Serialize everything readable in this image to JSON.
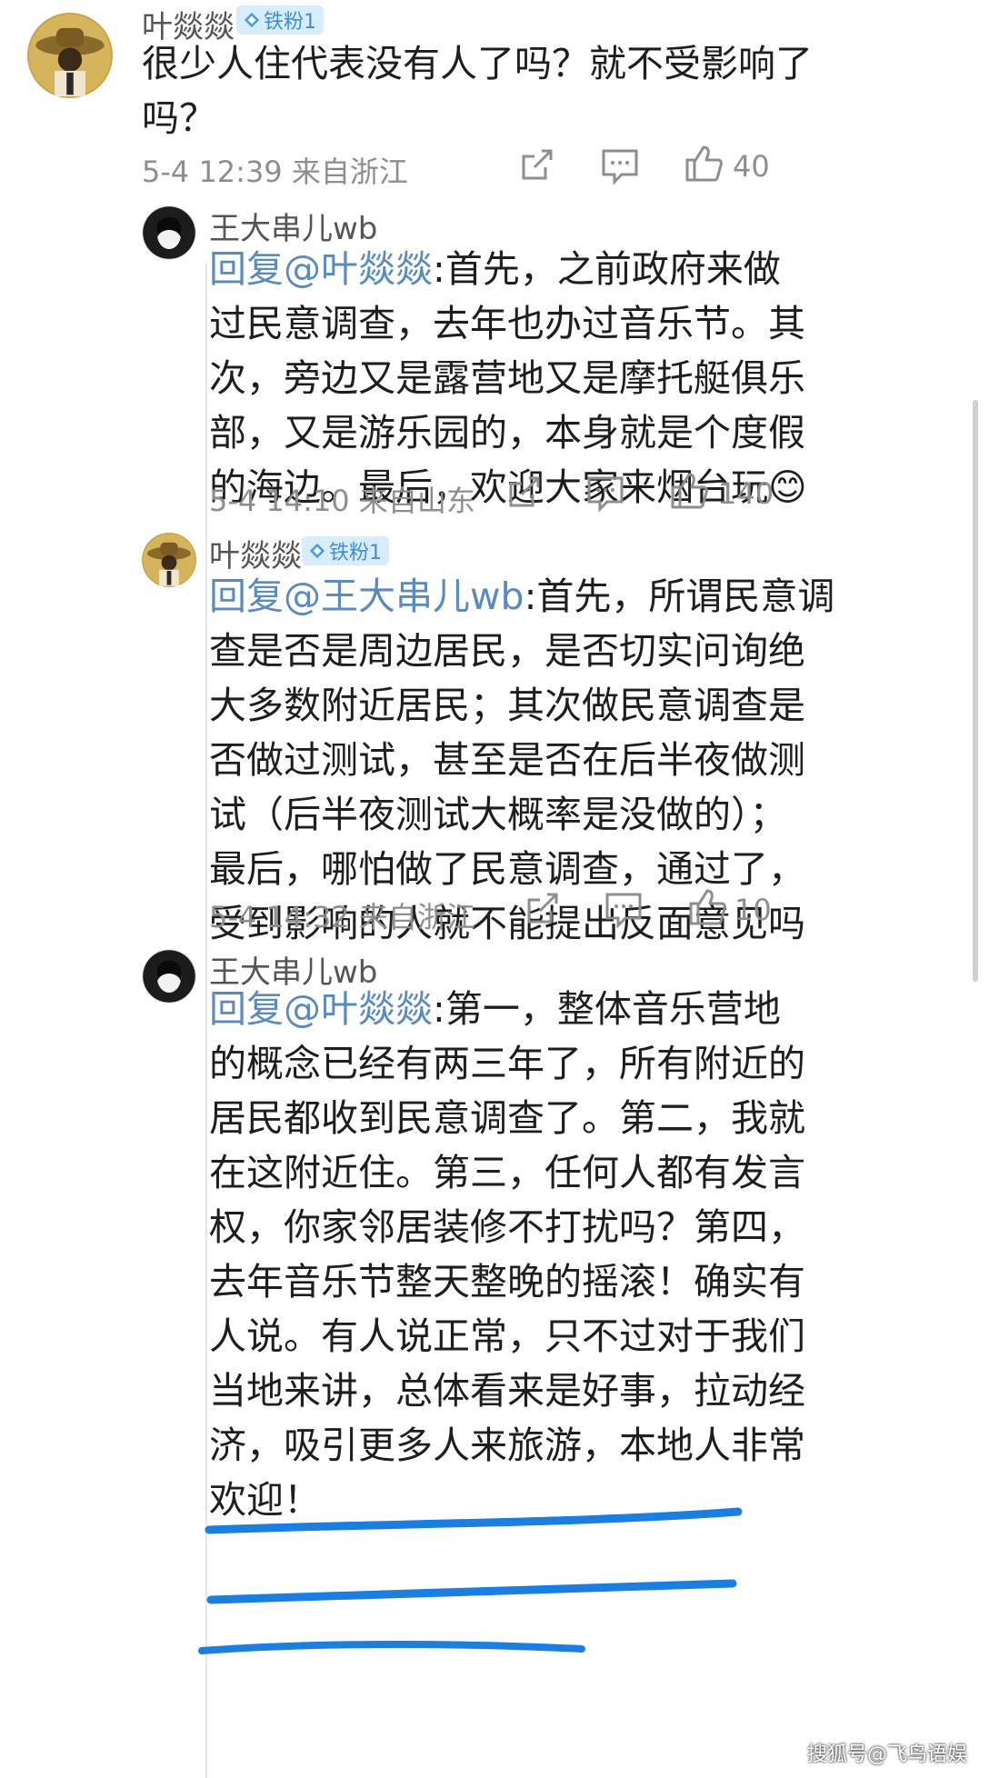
{
  "comments": [
    {
      "author": "叶燚燚",
      "badge": "铁粉1",
      "lines": [
        "很少人住代表没有人了吗？就不受影响了",
        "吗？"
      ],
      "date": "5-4 12:39",
      "location": "来自浙江",
      "likes": "40"
    },
    {
      "author": "王大串儿wb",
      "mention": "回复@叶燚燚",
      "lines_first_rest": ":首先，之前政府来做",
      "lines": [
        "过民意调查，去年也办过音乐节。其",
        "次，旁边又是露营地又是摩托艇俱乐",
        "部，又是游乐园的，本身就是个度假",
        "的海边。最后，欢迎大家来烟台玩"
      ],
      "emoji": "😊",
      "date": "5-4 14:10",
      "location": "来自山东",
      "likes": "140"
    },
    {
      "author": "叶燚燚",
      "badge": "铁粉1",
      "mention": "回复@王大串儿wb",
      "lines_first_rest": ":首先，所谓民意调",
      "lines": [
        "查是否是周边居民，是否切实问询绝",
        "大多数附近居民；其次做民意调查是",
        "否做过测试，甚至是否在后半夜做测",
        "试（后半夜测试大概率是没做的）；",
        "最后，哪怕做了民意调查，通过了，",
        "受到影响的人就不能提出反面意见吗"
      ],
      "date": "5-4 14:32",
      "location": "来自浙江",
      "likes": "10"
    },
    {
      "author": "王大串儿wb",
      "mention": "回复@叶燚燚",
      "lines_first_rest": ":第一，整体音乐营地",
      "lines": [
        "的概念已经有两三年了，所有附近的",
        "居民都收到民意调查了。第二，我就",
        "在这附近住。第三，任何人都有发言",
        "权，你家邻居装修不打扰吗？第四，",
        "去年音乐节整天整晚的摇滚！确实有",
        "人说。有人说正常，只不过对于我们",
        "当地来讲，总体看来是好事，拉动经",
        "济，吸引更多人来旅游，本地人非常",
        "欢迎！"
      ]
    }
  ],
  "watermark": "搜狐号@飞鸟语娱",
  "colors": {
    "mention": "#5a8bbf",
    "meta": "#8e8e8e",
    "badge_bg": "#d9ecfa",
    "badge_text": "#3d8fd6",
    "highlight_underline": "#1a7fe0"
  },
  "icons": [
    "share-icon",
    "comment-icon",
    "like-icon",
    "diamond-icon"
  ]
}
